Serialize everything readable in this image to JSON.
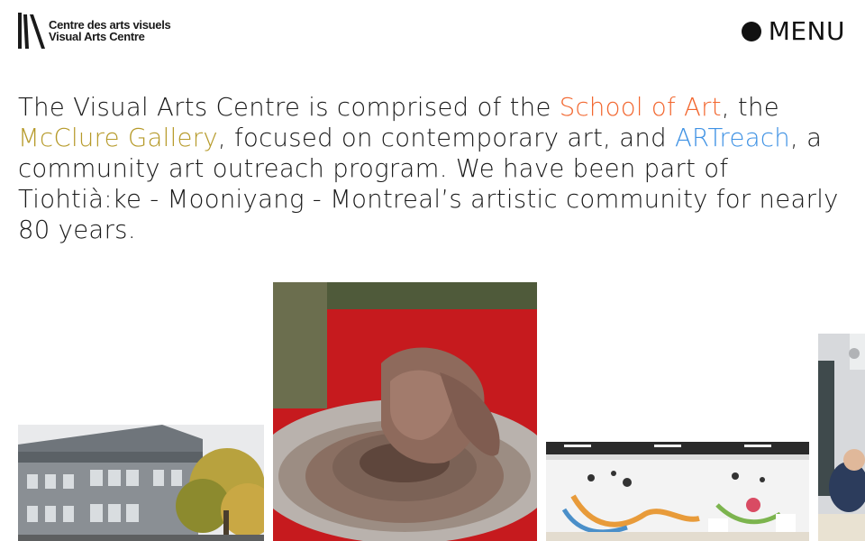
{
  "logo": {
    "line1": "Centre des arts visuels",
    "line2": "Visual Arts Centre"
  },
  "menu": {
    "label": "MENU"
  },
  "intro": {
    "part1": "The Visual Arts Centre is comprised of the ",
    "link_school": "School of Art",
    "part2": ", the ",
    "link_gallery": "McClure Gallery",
    "part3": ", focused on contemporary art, and ",
    "link_artreach": "ARTreach",
    "part4": ", a community art outreach program. We have been part of Tiohtià:ke - Mooniyang - Montreal’s artistic community for nearly 80 years."
  },
  "colors": {
    "school": "#f2662e",
    "gallery": "#b69a2a",
    "artreach": "#3f92e4",
    "text": "#1a1a1a"
  },
  "images": [
    {
      "name": "building-photo"
    },
    {
      "name": "pottery-wheel-photo"
    },
    {
      "name": "gallery-exhibition-photo"
    },
    {
      "name": "classroom-photo"
    }
  ]
}
